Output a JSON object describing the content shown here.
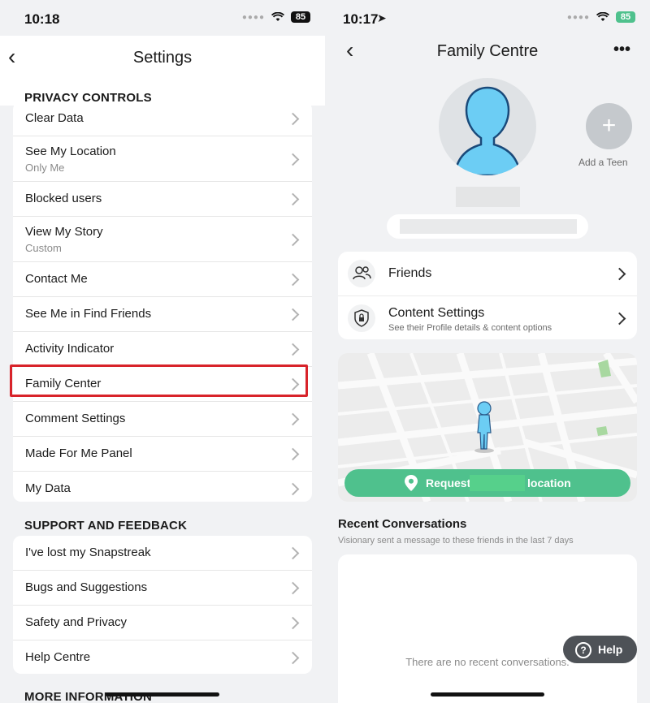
{
  "left": {
    "status": {
      "time": "10:18",
      "battery": "85"
    },
    "header": {
      "title": "Settings"
    },
    "privacy": {
      "heading": "PRIVACY CONTROLS",
      "items": [
        {
          "label": "Clear Data"
        },
        {
          "label": "See My Location",
          "sub": "Only Me"
        },
        {
          "label": "Blocked users"
        },
        {
          "label": "View My Story",
          "sub": "Custom"
        },
        {
          "label": "Contact Me"
        },
        {
          "label": "See Me in Find Friends"
        },
        {
          "label": "Activity Indicator"
        },
        {
          "label": "Family Center"
        },
        {
          "label": "Comment Settings"
        },
        {
          "label": "Made For Me Panel"
        },
        {
          "label": "My Data"
        }
      ]
    },
    "support": {
      "heading": "SUPPORT AND FEEDBACK",
      "items": [
        {
          "label": "I've lost my Snapstreak"
        },
        {
          "label": "Bugs and Suggestions"
        },
        {
          "label": "Safety and Privacy"
        },
        {
          "label": "Help Centre"
        }
      ]
    },
    "more": {
      "heading": "MORE INFORMATION"
    }
  },
  "right": {
    "status": {
      "time": "10:17",
      "battery": "85"
    },
    "header": {
      "title": "Family Centre"
    },
    "add_teen": {
      "label": "Add a Teen"
    },
    "menu": [
      {
        "label": "Friends",
        "icon": "friends-icon"
      },
      {
        "label": "Content Settings",
        "sub": "See their Profile details & content options",
        "icon": "shield-lock-icon"
      }
    ],
    "map": {
      "request_prefix": "Request",
      "request_suffix": "location"
    },
    "recent": {
      "title": "Recent Conversations",
      "subtitle": "Visionary sent a message to these friends in the last 7 days",
      "empty": "There are no recent conversations."
    },
    "help": {
      "label": "Help"
    }
  },
  "colors": {
    "highlight": "#d8232a",
    "map_button": "#4fc18d",
    "avatar": "#6ccdf4"
  }
}
